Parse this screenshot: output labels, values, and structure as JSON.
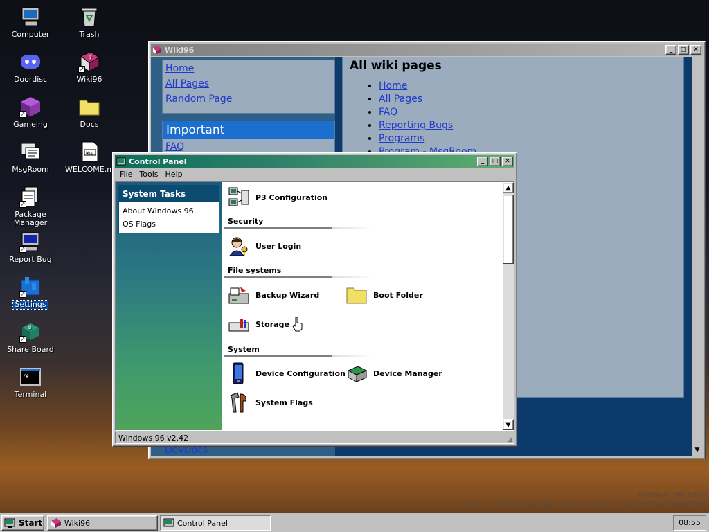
{
  "desktop": {
    "icons": [
      {
        "label": "Computer"
      },
      {
        "label": "Trash"
      },
      {
        "label": "Doordisc"
      },
      {
        "label": "Wiki96"
      },
      {
        "label": "Gameing"
      },
      {
        "label": "Docs"
      },
      {
        "label": "MsgRoom"
      },
      {
        "label": "WELCOME.md"
      },
      {
        "label": "Package Manager"
      },
      {
        "label": "Report Bug"
      },
      {
        "label": "Settings"
      },
      {
        "label": "Share Board"
      },
      {
        "label": "Terminal"
      }
    ],
    "watermark_line1": "Windows 96 main",
    "watermark_line2": "Build 11589.7b9a893a.211024-1119.52346c3d7ebf4b3d2683"
  },
  "wiki_window": {
    "title": "Wiki96",
    "sidebar_links": [
      "Home",
      "All Pages",
      "Random Page"
    ],
    "important_header": "Important",
    "important_links": [
      "FAQ"
    ],
    "bottom_link": "DevDocs",
    "main_heading": "All wiki pages",
    "page_list": [
      "Home",
      "All Pages",
      "FAQ",
      "Reporting Bugs",
      "Programs",
      "Program - MsgRoom"
    ]
  },
  "control_panel": {
    "title": "Control Panel",
    "menu": [
      "File",
      "Tools",
      "Help"
    ],
    "tasks_header": "System Tasks",
    "tasks": [
      "About Windows 96",
      "OS Flags"
    ],
    "items": {
      "p3_config": "P3 Configuration",
      "security_header": "Security",
      "user_login": "User Login",
      "fs_header": "File systems",
      "backup_wizard": "Backup Wizard",
      "boot_folder": "Boot Folder",
      "storage": "Storage",
      "system_header": "System",
      "device_config": "Device Configuration",
      "device_manager": "Device Manager",
      "system_flags": "System Flags"
    },
    "status": "Windows 96 v2.42"
  },
  "taskbar": {
    "start_label": "Start",
    "tasks": [
      "Wiki96",
      "Control Panel"
    ],
    "clock": "08:55"
  },
  "colors": {
    "title_active": "#0b6e5a",
    "desktop_selected": "#0a4fb0",
    "wiki_link": "#1f39c8"
  }
}
